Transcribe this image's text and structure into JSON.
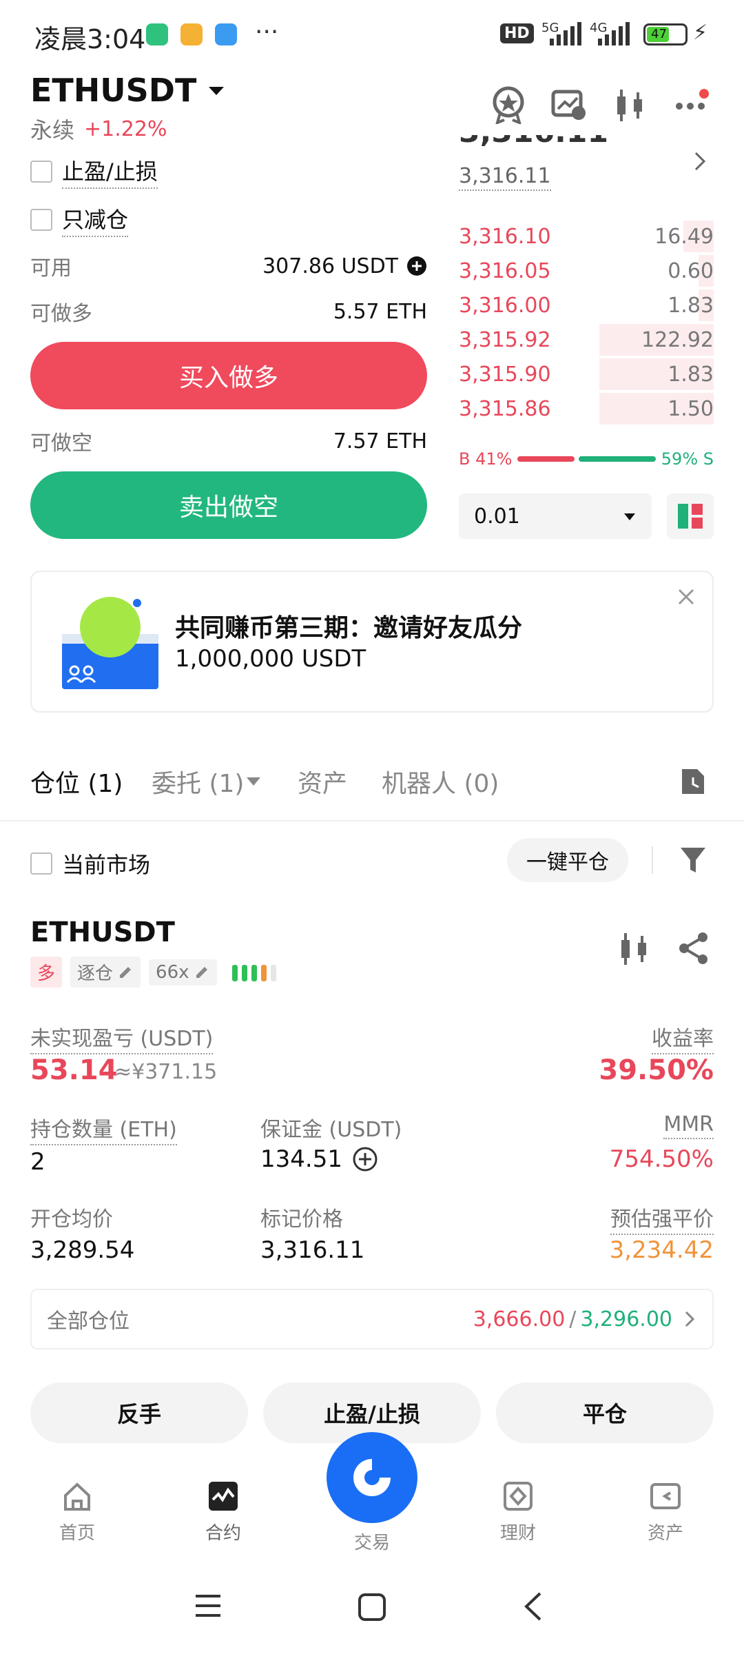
{
  "status_bar": {
    "time": "凌晨3:04",
    "more": "···",
    "hd": "HD",
    "net1": "5G",
    "net2": "4G",
    "battery": "47"
  },
  "header": {
    "symbol": "ETHUSDT",
    "subtype": "永续",
    "change": "+1.22%"
  },
  "order_form": {
    "tp_sl_label": "止盈/止损",
    "reduce_only_label": "只减仓",
    "available_label": "可用",
    "available_value": "307.86 USDT",
    "can_long_label": "可做多",
    "can_long_value": "5.57 ETH",
    "buy_button": "买入做多",
    "can_short_label": "可做空",
    "can_short_value": "7.57 ETH",
    "sell_button": "卖出做空"
  },
  "orderbook": {
    "cut_price": "3,316.11",
    "last_price": "3,316.11",
    "rows": [
      {
        "price": "3,316.10",
        "qty": "16.49",
        "depth": 0.12
      },
      {
        "price": "3,316.05",
        "qty": "0.60",
        "depth": 0.06
      },
      {
        "price": "3,316.00",
        "qty": "1.83",
        "depth": 0.06
      },
      {
        "price": "3,315.92",
        "qty": "122.92",
        "depth": 0.45
      },
      {
        "price": "3,315.90",
        "qty": "1.83",
        "depth": 0.45
      },
      {
        "price": "3,315.86",
        "qty": "1.50",
        "depth": 0.45
      }
    ],
    "buy_ratio": "B 41%",
    "sell_ratio": "59% S",
    "buy_fraction": 0.41,
    "precision": "0.01"
  },
  "banner": {
    "title": "共同赚币第三期：邀请好友瓜分",
    "subtitle": "1,000,000 USDT"
  },
  "tabs": [
    {
      "label": "仓位 (1)",
      "active": true
    },
    {
      "label": "委托 (1)",
      "active": false
    },
    {
      "label": "资产",
      "active": false
    },
    {
      "label": "机器人 (0)",
      "active": false
    }
  ],
  "filter": {
    "current_market_label": "当前市场",
    "close_all_button": "一键平仓"
  },
  "position": {
    "symbol": "ETHUSDT",
    "side_badge": "多",
    "margin_mode": "逐仓",
    "leverage": "66x",
    "upl_label": "未实现盈亏 (USDT)",
    "upl_value": "53.14",
    "upl_cny": "≈¥371.15",
    "roe_label": "收益率",
    "roe_value": "39.50%",
    "size_label": "持仓数量 (ETH)",
    "size_value": "2",
    "margin_label": "保证金 (USDT)",
    "margin_value": "134.51",
    "mmr_label": "MMR",
    "mmr_value": "754.50%",
    "entry_label": "开仓均价",
    "entry_value": "3,289.54",
    "mark_label": "标记价格",
    "mark_value": "3,316.11",
    "liq_label": "预估强平价",
    "liq_value": "3,234.42",
    "all_positions_label": "全部仓位",
    "tp_value": "3,666.00",
    "separator": "/",
    "sl_value": "3,296.00"
  },
  "actions": {
    "reverse": "反手",
    "tpsl": "止盈/止损",
    "close": "平仓"
  },
  "bottom_nav": [
    {
      "label": "首页"
    },
    {
      "label": "合约"
    },
    {
      "label": "交易"
    },
    {
      "label": "理财"
    },
    {
      "label": "资产"
    }
  ],
  "colors": {
    "red": "#e8475a",
    "green": "#20b07a",
    "orange": "#f0943a",
    "blue": "#1a6ef5"
  }
}
